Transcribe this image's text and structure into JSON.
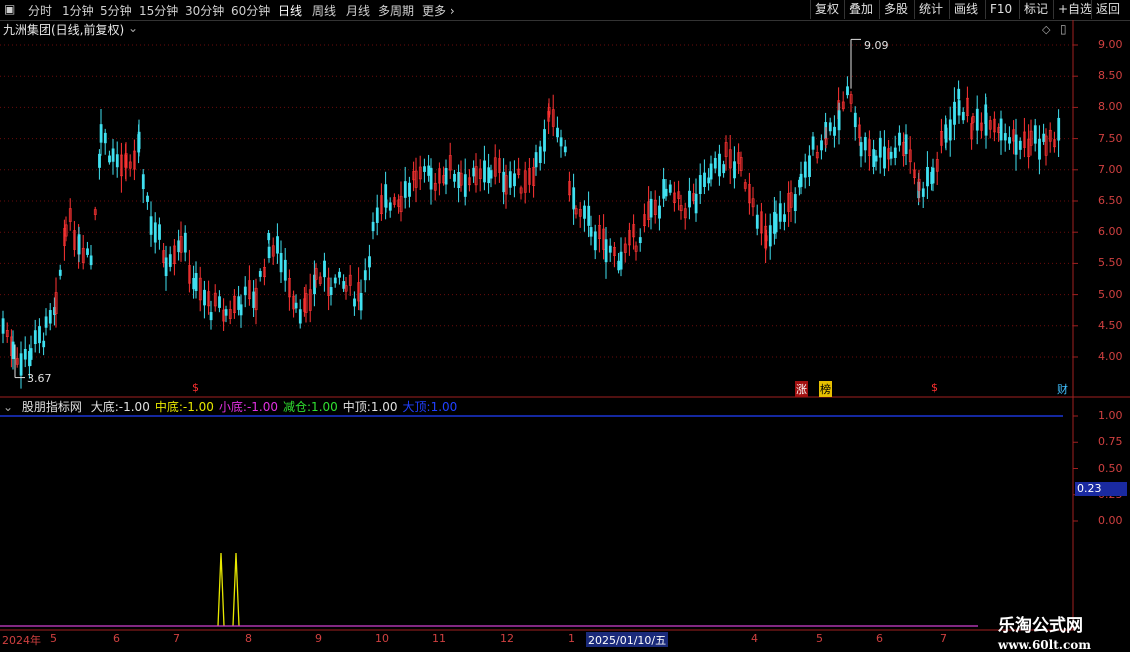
{
  "toolbar": {
    "periods": [
      "分时",
      "1分钟",
      "5分钟",
      "15分钟",
      "30分钟",
      "60分钟",
      "日线",
      "周线",
      "月线",
      "多周期",
      "更多"
    ],
    "active_period": "日线",
    "right_buttons": [
      "复权",
      "叠加",
      "多股",
      "统计",
      "画线",
      "F10",
      "标记",
      "+自选",
      "返回"
    ]
  },
  "main_chart": {
    "title": "九洲集团(日线,前复权)",
    "y_ticks": [
      "9.00",
      "8.50",
      "8.00",
      "7.50",
      "7.00",
      "6.50",
      "6.00",
      "5.50",
      "5.00",
      "4.50",
      "4.00"
    ],
    "high_label": "9.09",
    "low_label": "3.67",
    "markers": {
      "zhang": "涨",
      "bang": "榜",
      "cai": "财",
      "dollar": "$"
    }
  },
  "indicator": {
    "name": "股朋指标网",
    "fields": [
      {
        "label": "大底:",
        "value": "-1.00",
        "color": "#e0e0e0"
      },
      {
        "label": "中底:",
        "value": "-1.00",
        "color": "#e8e800"
      },
      {
        "label": "小底:",
        "value": "-1.00",
        "color": "#e030e0"
      },
      {
        "label": "减仓:",
        "value": "1.00",
        "color": "#30e030"
      },
      {
        "label": "中顶:",
        "value": "1.00",
        "color": "#e0e0e0"
      },
      {
        "label": "大顶:",
        "value": "1.00",
        "color": "#2040ff"
      }
    ],
    "y_ticks": [
      "1.00",
      "0.75",
      "0.50",
      "0.25",
      "0.00"
    ],
    "current_value": "0.23"
  },
  "date_axis": {
    "labels": [
      "2024年",
      "5",
      "6",
      "7",
      "8",
      "9",
      "10",
      "11",
      "12",
      "1",
      "5",
      "6",
      "7",
      "4"
    ],
    "highlight": "2025/01/10/五"
  },
  "watermark": {
    "line1": "乐淘公式网",
    "line2": "www.60lt.com"
  },
  "colors": {
    "up": "#ff3333",
    "down": "#40e0f0",
    "axis": "#a02020",
    "grid": "#7a1010"
  }
}
